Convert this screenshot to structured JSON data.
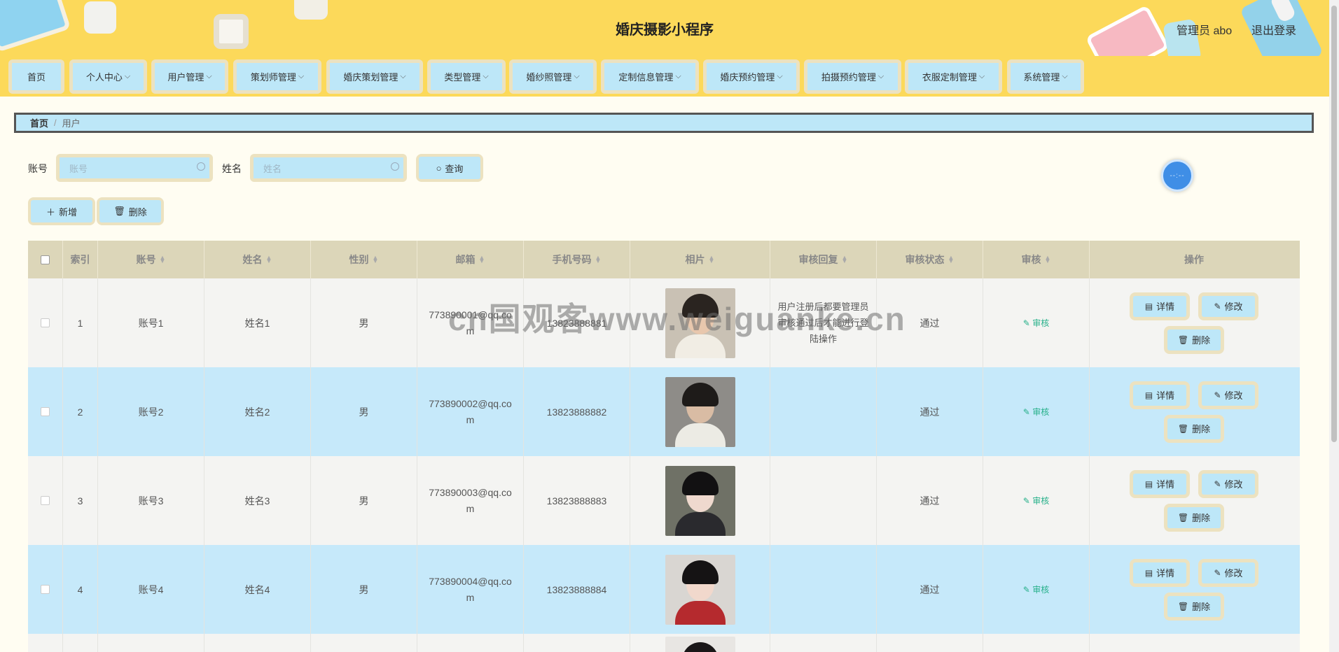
{
  "header": {
    "title": "婚庆摄影小程序",
    "admin": "管理员 abo",
    "logout": "退出登录"
  },
  "nav": [
    {
      "label": "首页",
      "chevron": false
    },
    {
      "label": "个人中心",
      "chevron": true
    },
    {
      "label": "用户管理",
      "chevron": true
    },
    {
      "label": "策划师管理",
      "chevron": true
    },
    {
      "label": "婚庆策划管理",
      "chevron": true
    },
    {
      "label": "类型管理",
      "chevron": true
    },
    {
      "label": "婚纱照管理",
      "chevron": true
    },
    {
      "label": "定制信息管理",
      "chevron": true
    },
    {
      "label": "婚庆预约管理",
      "chevron": true
    },
    {
      "label": "拍摄预约管理",
      "chevron": true
    },
    {
      "label": "衣服定制管理",
      "chevron": true
    },
    {
      "label": "系统管理",
      "chevron": true
    }
  ],
  "breadcrumb": {
    "home": "首页",
    "separator": "/",
    "current": "用户"
  },
  "search": {
    "account_label": "账号",
    "account_placeholder": "账号",
    "name_label": "姓名",
    "name_placeholder": "姓名",
    "query_button": "查询"
  },
  "actions": {
    "add": "新增",
    "delete": "删除"
  },
  "table": {
    "headers": [
      "索引",
      "账号",
      "姓名",
      "性别",
      "邮箱",
      "手机号码",
      "相片",
      "审核回复",
      "审核状态",
      "审核",
      "操作"
    ],
    "rows": [
      {
        "index": "1",
        "account": "账号1",
        "name": "姓名1",
        "gender": "男",
        "email": "773890001@qq.com",
        "phone": "13823888881",
        "reply": "用户注册后都要管理员审核通过后才能进行登陆操作",
        "status": "通过",
        "audit": "审核"
      },
      {
        "index": "2",
        "account": "账号2",
        "name": "姓名2",
        "gender": "男",
        "email": "773890002@qq.com",
        "phone": "13823888882",
        "reply": "",
        "status": "通过",
        "audit": "审核"
      },
      {
        "index": "3",
        "account": "账号3",
        "name": "姓名3",
        "gender": "男",
        "email": "773890003@qq.com",
        "phone": "13823888883",
        "reply": "",
        "status": "通过",
        "audit": "审核"
      },
      {
        "index": "4",
        "account": "账号4",
        "name": "姓名4",
        "gender": "男",
        "email": "773890004@qq.com",
        "phone": "13823888884",
        "reply": "",
        "status": "通过",
        "audit": "审核"
      }
    ],
    "row_actions": {
      "detail": "详情",
      "edit": "修改",
      "delete": "删除"
    }
  },
  "watermark": "cn国观客www.weiguanke.cn",
  "colors": {
    "header_bg": "#fcd95a",
    "button_bg": "#bde7f8",
    "button_frame": "#ece2c0",
    "table_header_bg": "#dcd6b9",
    "row_alt_bg": "#c6e9fa",
    "audit_link": "#26b08a"
  },
  "icons": {
    "search": "magnifier-icon",
    "add": "plus-icon",
    "delete": "trash-icon",
    "detail": "document-icon",
    "edit": "pencil-icon",
    "float": "clock-icon"
  }
}
